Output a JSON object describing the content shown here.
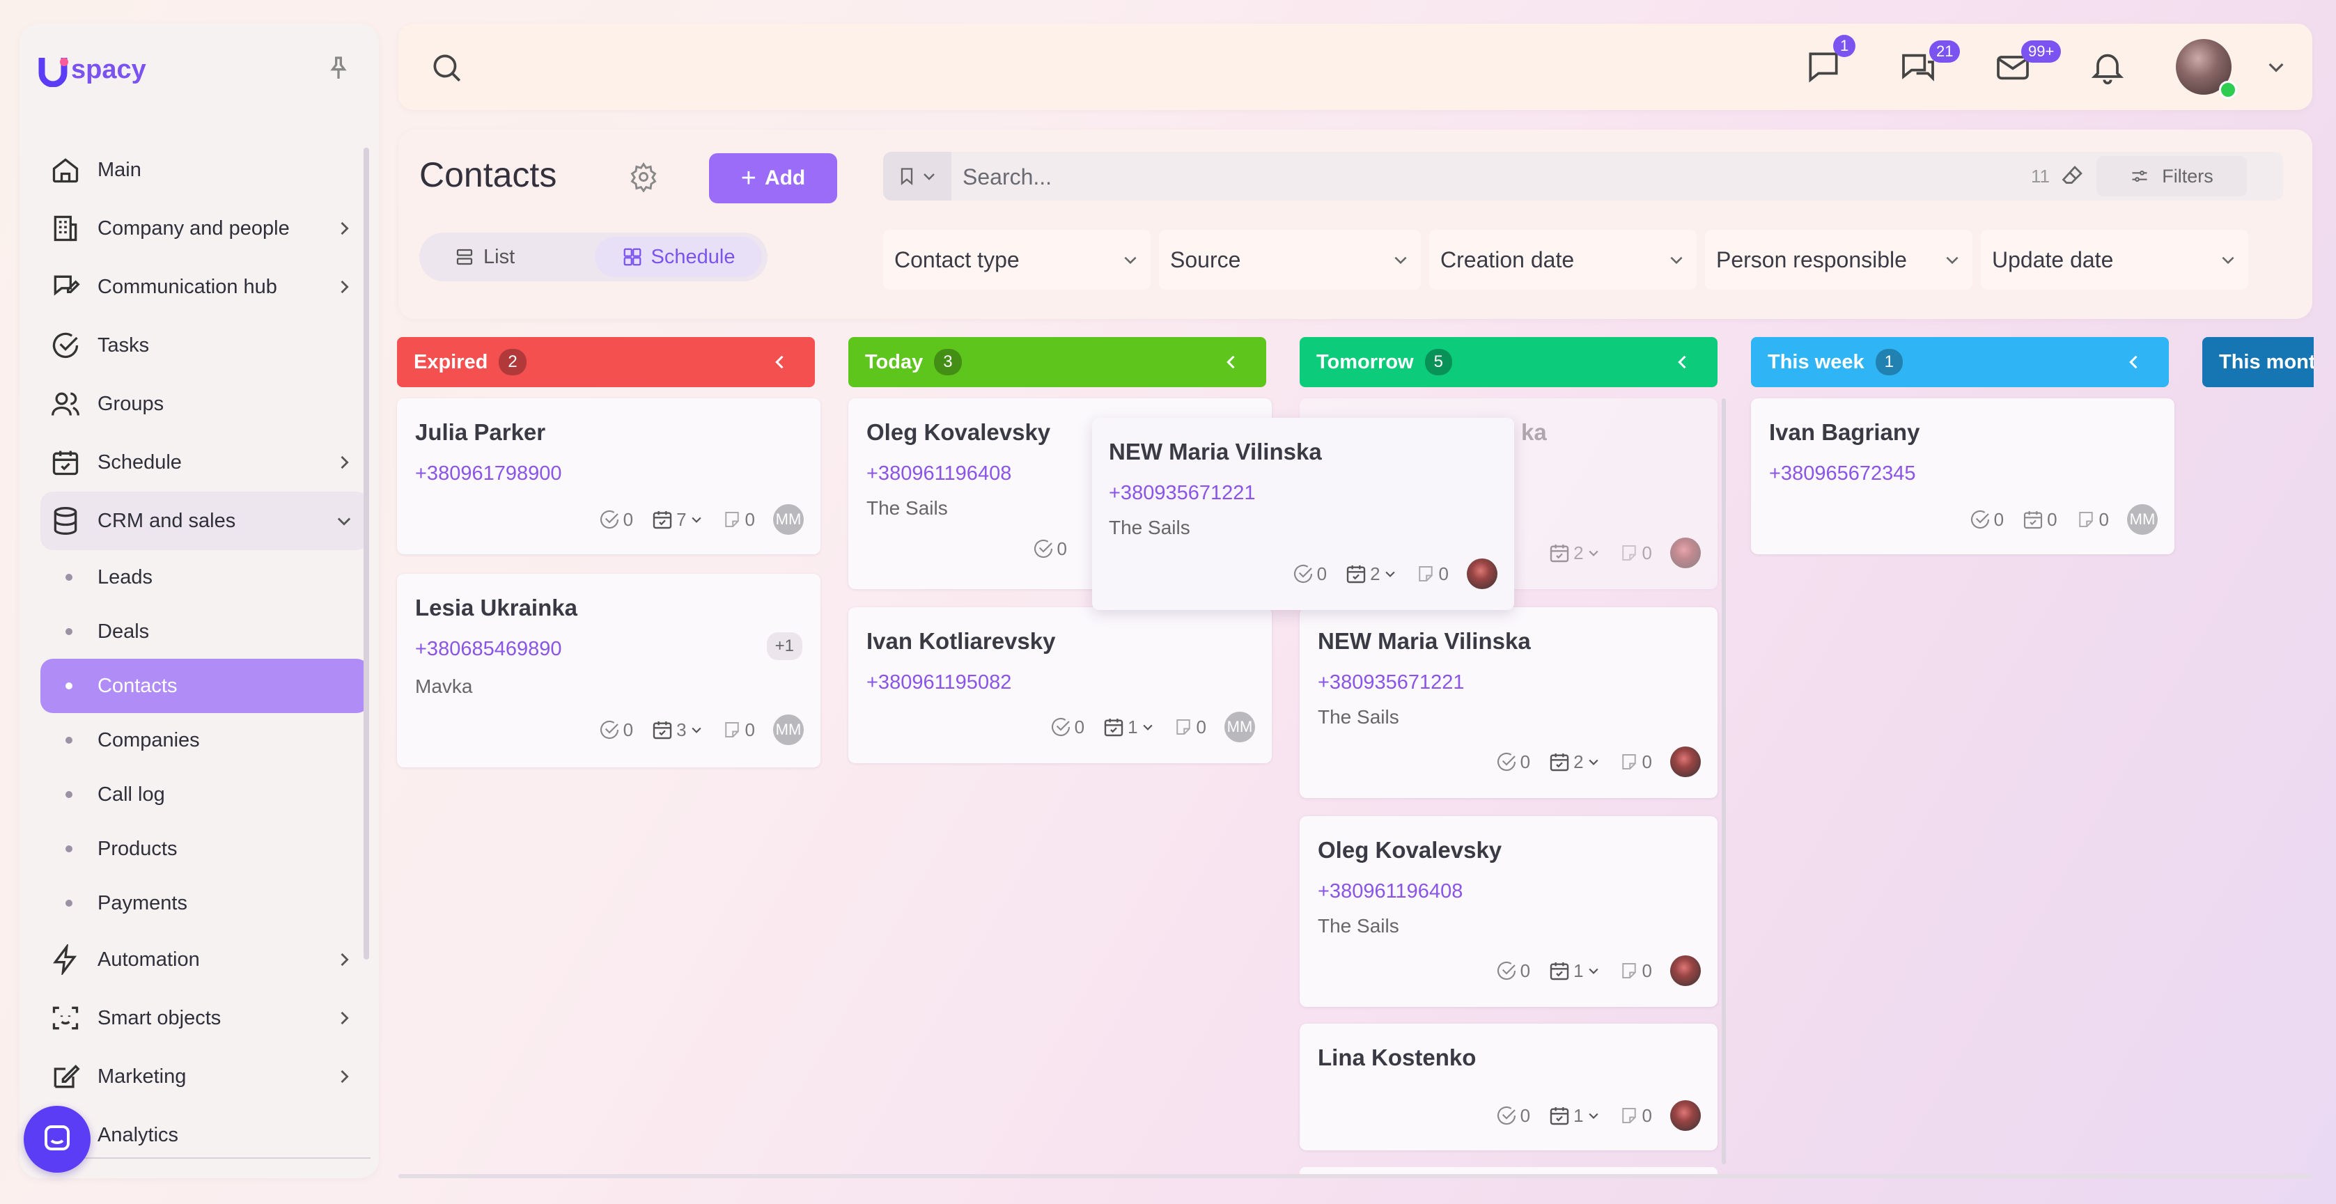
{
  "app": {
    "logo_text": "spacy"
  },
  "sidebar": {
    "items": [
      {
        "label": "Main",
        "icon": "home-icon"
      },
      {
        "label": "Company and people",
        "icon": "building-icon"
      },
      {
        "label": "Communication hub",
        "icon": "chat-edit-icon"
      },
      {
        "label": "Tasks",
        "icon": "check-circle-icon"
      },
      {
        "label": "Groups",
        "icon": "users-icon"
      },
      {
        "label": "Schedule",
        "icon": "calendar-check-icon"
      },
      {
        "label": "CRM and sales",
        "icon": "database-icon"
      },
      {
        "label": "Automation",
        "icon": "lightning-icon"
      },
      {
        "label": "Smart objects",
        "icon": "scan-face-icon"
      },
      {
        "label": "Marketing",
        "icon": "edit-square-icon"
      },
      {
        "label": "Analytics",
        "icon": "chart-icon"
      }
    ],
    "crm_sub": [
      "Leads",
      "Deals",
      "Contacts",
      "Companies",
      "Call log",
      "Products",
      "Payments"
    ],
    "active_sub": "Contacts"
  },
  "topbar": {
    "badges": {
      "messages": "1",
      "chats": "21",
      "mail": "99+"
    }
  },
  "page": {
    "title": "Contacts",
    "add_label": "Add",
    "view_list": "List",
    "view_schedule": "Schedule",
    "search_placeholder": "Search...",
    "result_count": "11",
    "filters_label": "Filters",
    "filters": [
      "Contact type",
      "Source",
      "Creation date",
      "Person responsible",
      "Update date"
    ]
  },
  "columns": [
    {
      "title": "Expired",
      "count": "2",
      "color": "#f55050"
    },
    {
      "title": "Today",
      "count": "3",
      "color": "#5ec51d"
    },
    {
      "title": "Tomorrow",
      "count": "5",
      "color": "#0ccb7a"
    },
    {
      "title": "This week",
      "count": "1",
      "color": "#2fb4f5"
    },
    {
      "title": "This mont",
      "color": "#1676b3"
    }
  ],
  "cards": {
    "expired": [
      {
        "name": "Julia Parker",
        "phone": "+380961798900",
        "tasks": "0",
        "events": "7",
        "notes": "0",
        "avatar": "MM"
      },
      {
        "name": "Lesia Ukrainka",
        "phone": "+380685469890",
        "extra": "+1",
        "company": "Mavka",
        "tasks": "0",
        "events": "3",
        "notes": "0",
        "avatar": "MM"
      }
    ],
    "today": [
      {
        "name": "Oleg Kovalevsky",
        "phone": "+380961196408",
        "company": "The Sails",
        "tasks": "0"
      },
      {
        "name": "Ivan Kotliarevsky",
        "phone": "+380961195082",
        "tasks": "0",
        "events": "1",
        "notes": "0",
        "avatar": "MM"
      }
    ],
    "tomorrow": [
      {
        "name_fragment": "ka",
        "events": "2",
        "notes": "0"
      },
      {
        "name": "NEW Maria Vilinska",
        "phone": "+380935671221",
        "company": "The Sails",
        "tasks": "0",
        "events": "2",
        "notes": "0"
      },
      {
        "name": "Oleg Kovalevsky",
        "phone": "+380961196408",
        "company": "The Sails",
        "tasks": "0",
        "events": "1",
        "notes": "0"
      },
      {
        "name": "Lina Kostenko",
        "tasks": "0",
        "events": "1",
        "notes": "0"
      }
    ],
    "this_week": [
      {
        "name": "Ivan Bagriany",
        "phone": "+380965672345",
        "tasks": "0",
        "events": "0",
        "notes": "0",
        "avatar": "MM"
      }
    ],
    "dragging": {
      "name": "NEW Maria Vilinska",
      "phone": "+380935671221",
      "company": "The Sails",
      "tasks": "0",
      "events": "2",
      "notes": "0"
    }
  }
}
